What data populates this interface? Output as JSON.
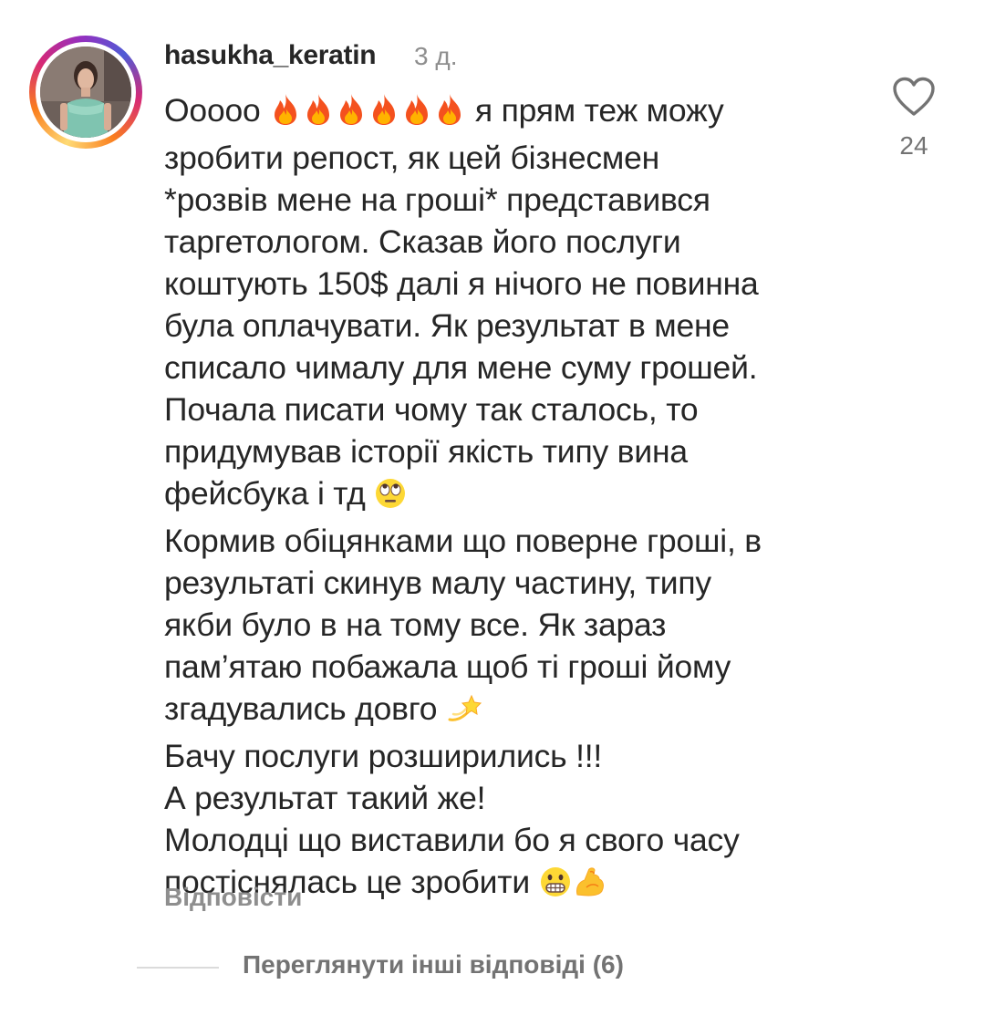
{
  "comment": {
    "username": "hasukha_keratin",
    "time": "3 д.",
    "lines": [
      "Ооооо [fire][fire][fire][fire][fire][fire] я прям теж можу",
      "зробити репост, як цей бізнесмен",
      "*розвів мене на гроші* представився",
      "таргетологом. Сказав його послуги",
      "коштують 150$ далі я нічого не повинна",
      "була оплачувати. Як результат в мене",
      "списало чималу для мене суму грошей.",
      "Почала писати чому так сталось, то",
      "придумував історії якість типу вина",
      "фейсбука і тд [eyeroll]",
      "Кормив обіцянками що поверне гроші, в",
      "результаті скинув малу частину, типу",
      "якби було в на тому все. Як зараз",
      "пам’ятаю побажала щоб ті гроші йому",
      "згадувались довго [dizzy]",
      "Бачу послуги розширились !!!",
      "А результат такий же!",
      "Молодці що виставили бо я свого часу",
      "постіснялась це зробити [grimace][muscle]"
    ],
    "likes": "24",
    "reply_label": "Відповісти",
    "view_replies_label": "Переглянути інші відповіді (6)"
  },
  "icons": {
    "like": "heart-outline-icon",
    "fire": "fire-emoji",
    "eyeroll": "face-with-rolling-eyes-emoji",
    "dizzy": "dizzy-emoji",
    "grimace": "grimacing-face-emoji",
    "muscle": "flexed-biceps-emoji"
  },
  "colors": {
    "text": "#262626",
    "muted": "#8e8e8e",
    "divider": "#dbdbdb"
  }
}
